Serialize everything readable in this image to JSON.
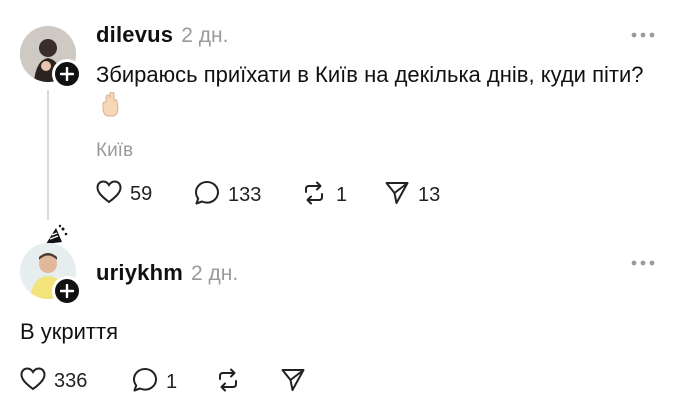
{
  "post": {
    "username": "dilevus",
    "time": "2 дн.",
    "text": "Збираюсь приїхати в Київ на декілька днів, куди піти?",
    "location": "Київ",
    "likes": "59",
    "replies": "133",
    "reposts": "1",
    "shares": "13",
    "icons": [
      "avatar",
      "follow-plus-icon",
      "more-icon",
      "hand-emoji-icon",
      "heart-icon",
      "comment-icon",
      "repost-icon",
      "share-icon"
    ]
  },
  "reply": {
    "username": "uriykhm",
    "time": "2 дн.",
    "text": "В укриття",
    "likes": "336",
    "replies": "1",
    "icons": [
      "avatar",
      "follow-plus-icon",
      "more-icon",
      "heart-icon",
      "comment-icon",
      "repost-icon",
      "share-icon"
    ]
  },
  "colors": {
    "text": "#111111",
    "muted": "#9a9a9a",
    "line": "#dadada",
    "background": "#ffffff"
  }
}
